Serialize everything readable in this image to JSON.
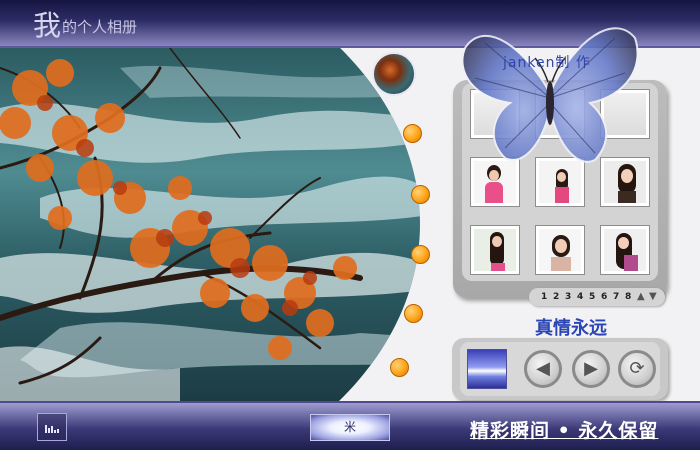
{
  "header": {
    "title_big": "我",
    "title_small": "的个人相册"
  },
  "credit": "janken制 作",
  "gallery": {
    "thumbnails": [
      {
        "label": "photo-1"
      },
      {
        "label": "photo-2"
      },
      {
        "label": "photo-3"
      },
      {
        "label": "photo-4"
      },
      {
        "label": "photo-5"
      },
      {
        "label": "photo-6"
      },
      {
        "label": "photo-7"
      },
      {
        "label": "photo-8"
      },
      {
        "label": "photo-9"
      }
    ],
    "pages": [
      "1",
      "2",
      "3",
      "4",
      "5",
      "6",
      "7",
      "8"
    ],
    "prev_arrow": "▲",
    "next_arrow": "▼"
  },
  "motto": "真情永远",
  "controls": {
    "prev": "◀",
    "next": "▶",
    "loop": "⟳"
  },
  "footer": {
    "music_button": "米",
    "slogan": "精彩瞬间 • 永久保留"
  },
  "colors": {
    "header_dark": "#151542",
    "accent_orange": "#ffa318",
    "text_blue": "#2a45b5"
  }
}
